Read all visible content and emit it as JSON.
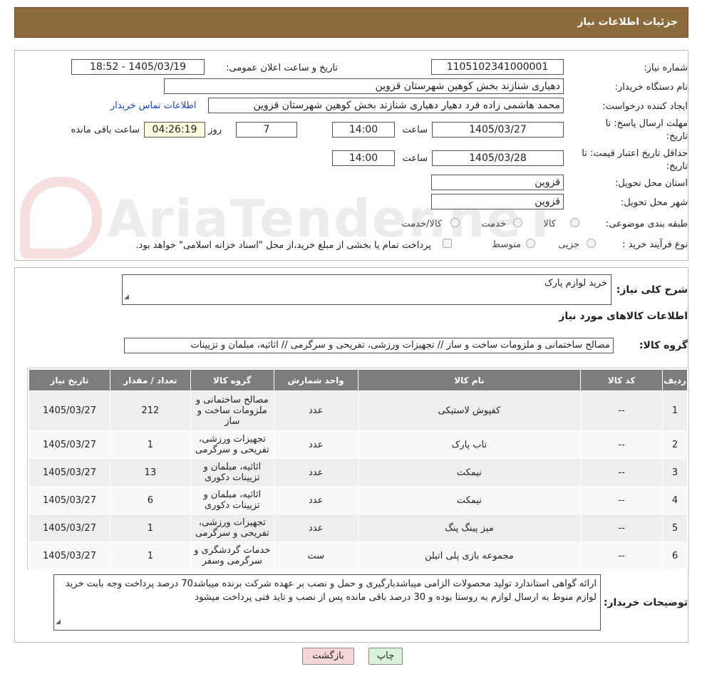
{
  "header": {
    "title": "جزئیات اطلاعات نیاز"
  },
  "form": {
    "need_number_label": "شماره نیاز:",
    "need_number": "1105102341000001",
    "announce_label": "تاریخ و ساعت اعلان عمومی:",
    "announce_value": "1405/03/19 - 18:52",
    "buyer_org_label": "نام دستگاه خریدار:",
    "buyer_org": "دهیاری شنازند بخش کوهین شهرستان قزوین",
    "creator_label": "ایجاد کننده درخواست:",
    "creator": "محمد هاشمی زاده فرد دهیار دهیاری شنازند بخش کوهین شهرستان قزوین",
    "contact_link": "اطلاعات تماس خریدار",
    "deadline_label_1": "مهلت ارسال پاسخ: تا",
    "deadline_label_2": "تاریخ:",
    "deadline_date": "1405/03/27",
    "time_label": "ساعت",
    "deadline_time": "14:00",
    "days_value": "7",
    "days_label": "روز و",
    "remaining_time": "04:26:19",
    "remaining_label": "ساعت باقی مانده",
    "validity_label_1": "حداقل تاریخ اعتبار قیمت: تا",
    "validity_label_2": "تاریخ:",
    "validity_date": "1405/03/28",
    "validity_time": "14:00",
    "province_label": "استان محل تحویل:",
    "province": "قزوین",
    "city_label": "شهر محل تحویل:",
    "city": "قزوین",
    "category_label": "طبقه بندی موضوعی:",
    "category_options": [
      "کالا",
      "خدمت",
      "کالا/خدمت"
    ],
    "purchase_type_label": "نوع فرآیند خرید :",
    "purchase_options": [
      "جزیی",
      "متوسط"
    ],
    "treasury_note": "پرداخت تمام یا بخشی از مبلغ خرید،از محل \"اسناد خزانه اسلامی\" خواهد بود."
  },
  "summary": {
    "desc_label": "شرح کلی نیاز:",
    "desc_value": "خرید لوازم پارک",
    "items_title": "اطلاعات کالاهای مورد نیاز",
    "group_label": "گروه کالا:",
    "group_value": "مصالح ساختمانی و ملزومات ساخت و ساز // تجهیزات ورزشی، تفریحی و سرگرمی // اثاثیه، مبلمان و تزیینات"
  },
  "table": {
    "headers": [
      "ردیف",
      "کد کالا",
      "نام کالا",
      "واحد شمارش",
      "گروه کالا",
      "تعداد / مقدار",
      "تاریخ نیاز"
    ],
    "rows": [
      {
        "idx": "1",
        "code": "--",
        "name": "کفپوش لاستیکی",
        "unit": "عدد",
        "group": "مصالح ساختمانی و ملزومات ساخت و ساز",
        "qty": "212",
        "date": "1405/03/27"
      },
      {
        "idx": "2",
        "code": "--",
        "name": "تاب پارک",
        "unit": "عدد",
        "group": "تجهیزات ورزشی، تفریحی و سرگرمی",
        "qty": "1",
        "date": "1405/03/27"
      },
      {
        "idx": "3",
        "code": "--",
        "name": "نیمکت",
        "unit": "عدد",
        "group": "اثاثیه، مبلمان و تزیینات دکوری",
        "qty": "13",
        "date": "1405/03/27"
      },
      {
        "idx": "4",
        "code": "--",
        "name": "نیمکت",
        "unit": "عدد",
        "group": "اثاثیه، مبلمان و تزیینات دکوری",
        "qty": "6",
        "date": "1405/03/27"
      },
      {
        "idx": "5",
        "code": "--",
        "name": "میز پینگ پنگ",
        "unit": "عدد",
        "group": "تجهیزات ورزشی، تفریحی و سرگرمی",
        "qty": "1",
        "date": "1405/03/27"
      },
      {
        "idx": "6",
        "code": "--",
        "name": "مجموعه بازی پلی اتیلن",
        "unit": "ست",
        "group": "خدمات گردشگری و سرگرمی وسفر",
        "qty": "1",
        "date": "1405/03/27"
      }
    ]
  },
  "buyer_notes": {
    "label": "توضیحات خریدار:",
    "text": "ارائه گواهی استاندارد تولید محصولات الزامی میباشدبارگیری و حمل و نصب بر عهده شرکت برنده میباشد70 درصد پرداخت وجه بابت خرید لوازم منوط به ارسال لوازم به روستا بوده و 30 درصد باقی مانده پس از نصب و تاید فنی  پرداخت میشود"
  },
  "buttons": {
    "print": "چاپ",
    "back": "بازگشت"
  },
  "watermark": "AriaTender.neT",
  "colors": {
    "header": "#8c6a3c",
    "table_header": "#7d7d7d",
    "back_button": "#f6d6d6",
    "print_button": "#d9f2d9",
    "link": "#1a3fbf"
  }
}
